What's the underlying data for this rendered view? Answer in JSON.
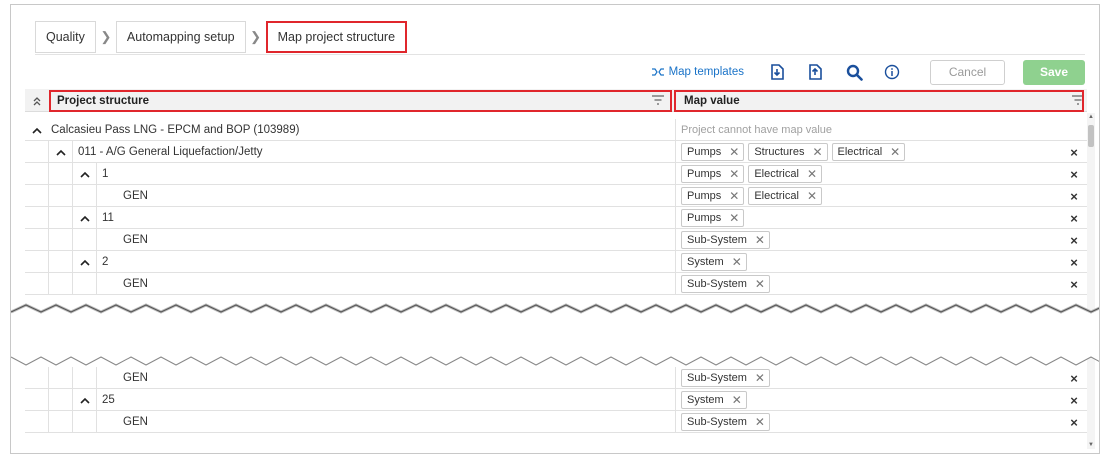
{
  "breadcrumb": [
    {
      "label": "Quality"
    },
    {
      "label": "Automapping setup"
    },
    {
      "label": "Map project structure"
    }
  ],
  "toolbar": {
    "map_templates": "Map templates",
    "cancel": "Cancel",
    "save": "Save",
    "icons": [
      "map-templates-icon",
      "import-icon",
      "export-icon",
      "search-icon",
      "info-icon"
    ]
  },
  "grid": {
    "columns": {
      "project_structure": "Project structure",
      "map_value": "Map value"
    },
    "placeholder": "Project cannot have map value",
    "rows": [
      {
        "label": "Calcasieu Pass LNG - EPCM and BOP (103989)",
        "level": 0,
        "expanded": true,
        "chips": []
      },
      {
        "label": "011 - A/G General Liquefaction/Jetty",
        "level": 1,
        "expanded": true,
        "chips": [
          "Pumps",
          "Structures",
          "Electrical"
        ]
      },
      {
        "label": "1",
        "level": 2,
        "expanded": true,
        "chips": [
          "Pumps",
          "Electrical"
        ]
      },
      {
        "label": "GEN",
        "level": 3,
        "chips": [
          "Pumps",
          "Electrical"
        ]
      },
      {
        "label": "11",
        "level": 2,
        "expanded": true,
        "chips": [
          "Pumps"
        ]
      },
      {
        "label": "GEN",
        "level": 3,
        "chips": [
          "Sub-System"
        ]
      },
      {
        "label": "2",
        "level": 2,
        "expanded": true,
        "chips": [
          "System"
        ]
      },
      {
        "label": "GEN",
        "level": 3,
        "chips": [
          "Sub-System"
        ]
      },
      {
        "label": "GEN",
        "level": 3,
        "chips": [
          "Sub-System"
        ]
      },
      {
        "label": "25",
        "level": 2,
        "expanded": true,
        "chips": [
          "System"
        ]
      },
      {
        "label": "GEN",
        "level": 3,
        "chips": [
          "Sub-System"
        ]
      }
    ]
  },
  "colors": {
    "highlight": "#e0262c",
    "link": "#1a73c8",
    "save_button": "#8fd18f",
    "header_bg": "#f2f2f2"
  }
}
